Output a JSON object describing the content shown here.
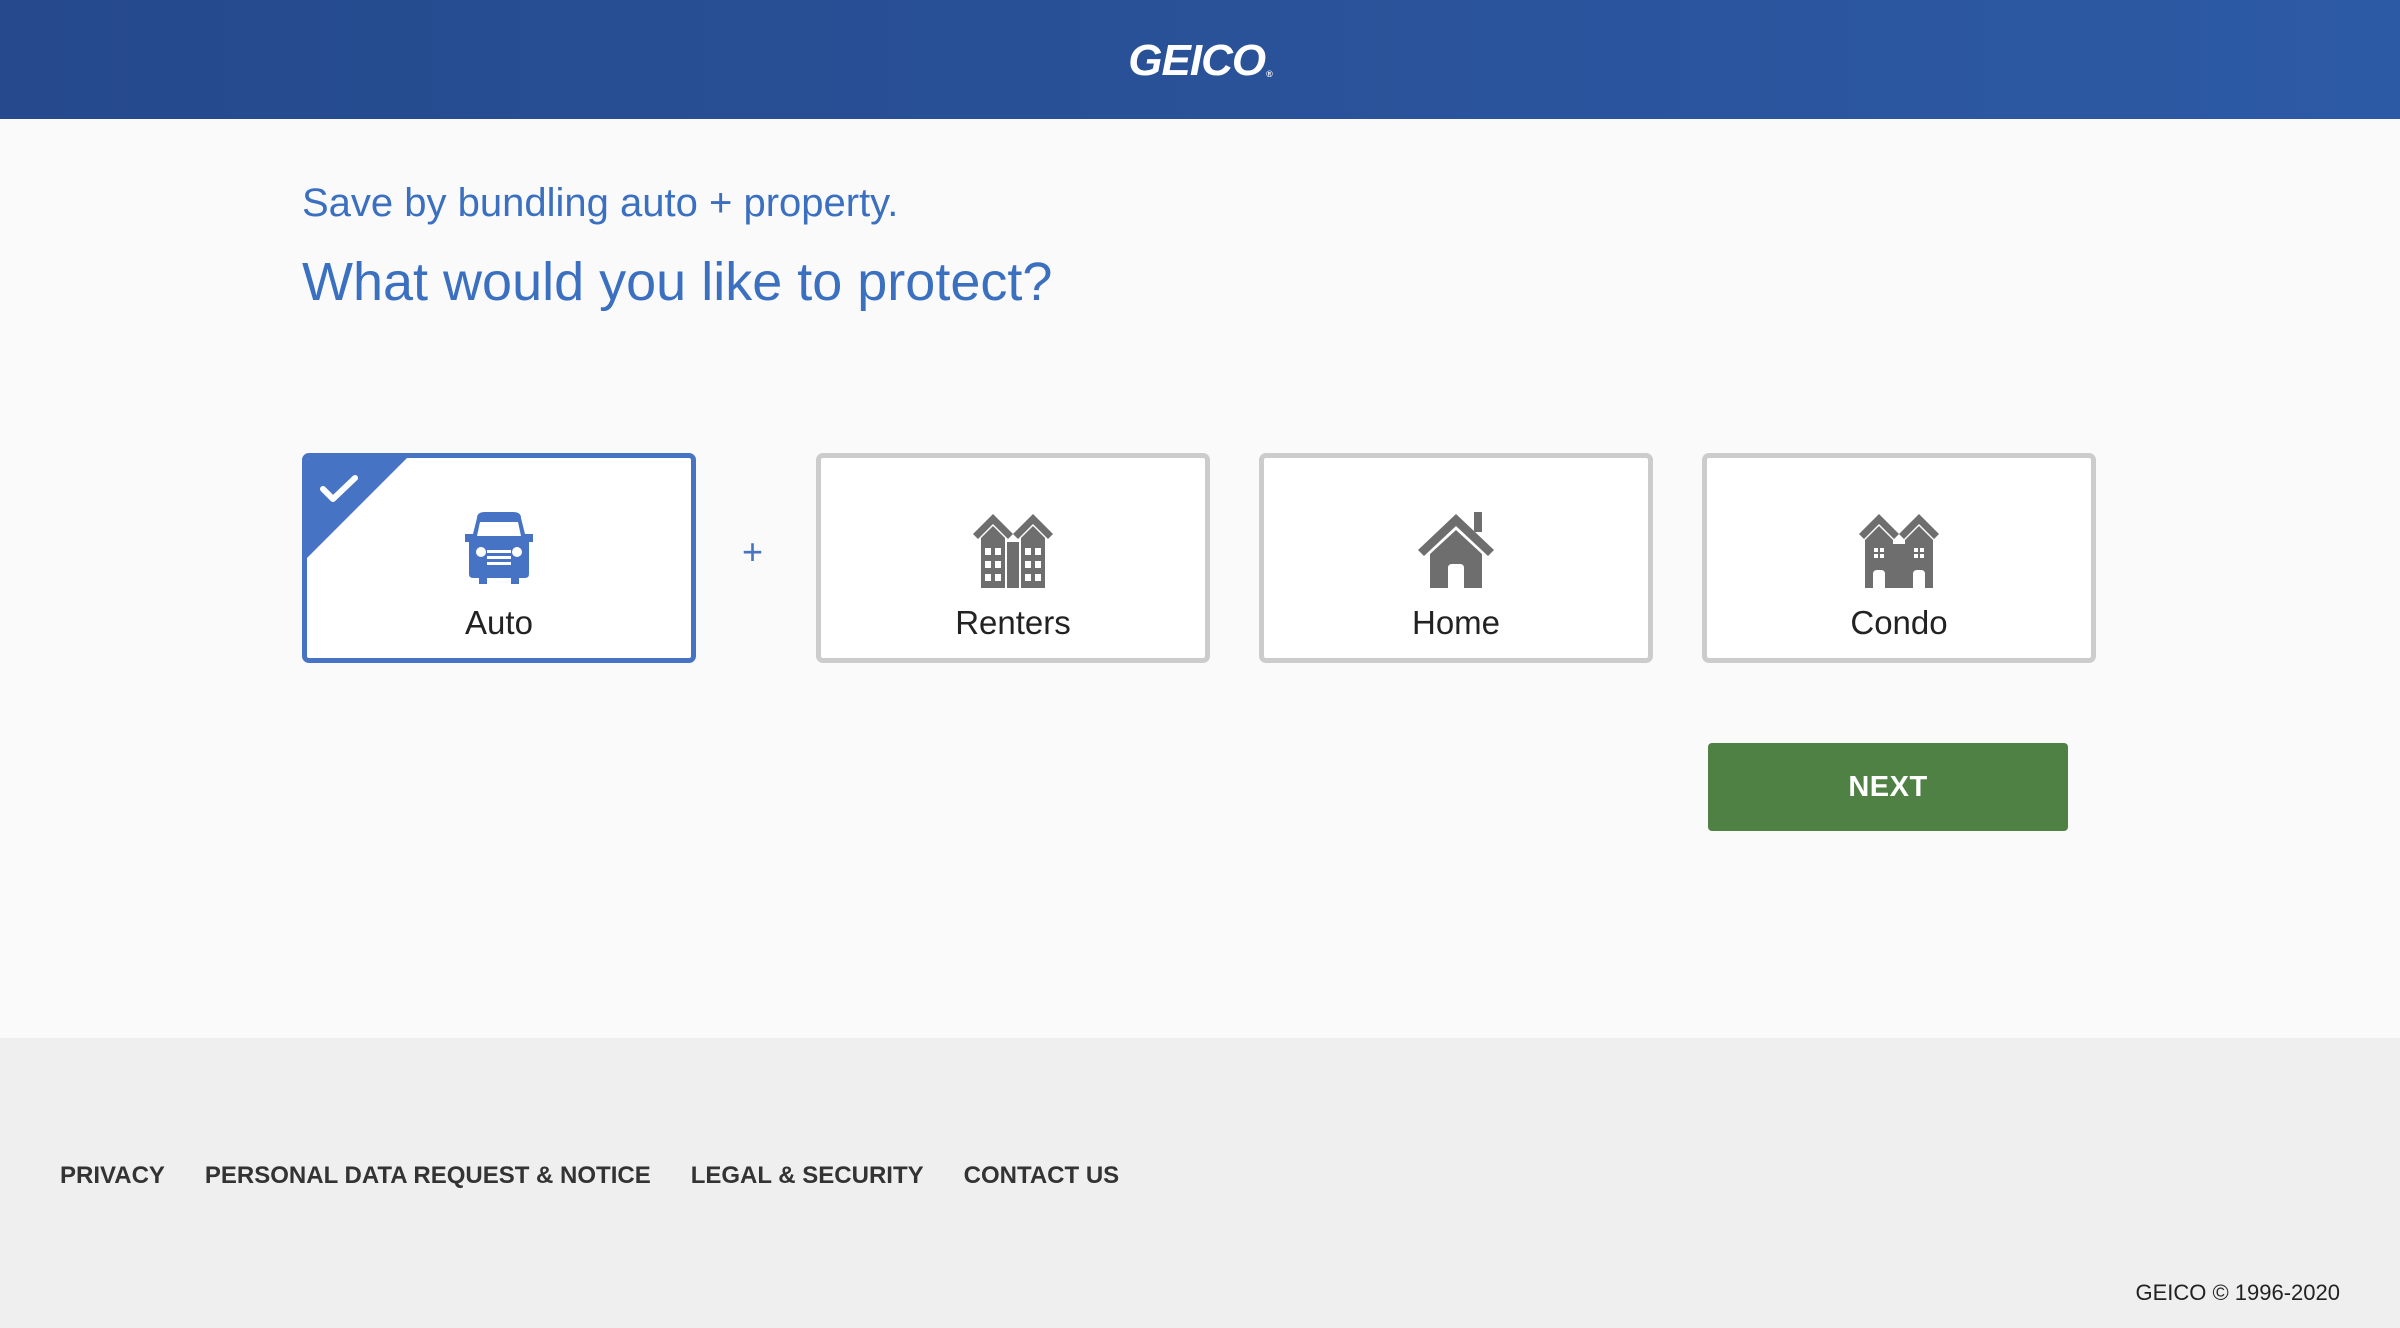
{
  "header": {
    "logo_text": "GEICO",
    "logo_mark": "®",
    "background": "#2a52a0"
  },
  "main": {
    "subtitle": "Save by bundling auto + property.",
    "title": "What would you like to protect?",
    "plus": "+",
    "options": [
      {
        "label": "Auto",
        "icon": "car-icon",
        "selected": true
      },
      {
        "label": "Renters",
        "icon": "apartment-icon",
        "selected": false
      },
      {
        "label": "Home",
        "icon": "house-icon",
        "selected": false
      },
      {
        "label": "Condo",
        "icon": "condo-icon",
        "selected": false
      }
    ],
    "next_label": "NEXT",
    "accent_color": "#4673c4",
    "next_color": "#4f8145"
  },
  "footer": {
    "links": [
      "PRIVACY",
      "PERSONAL DATA REQUEST & NOTICE",
      "LEGAL & SECURITY",
      "CONTACT US"
    ],
    "copyright": "GEICO © 1996-2020"
  }
}
